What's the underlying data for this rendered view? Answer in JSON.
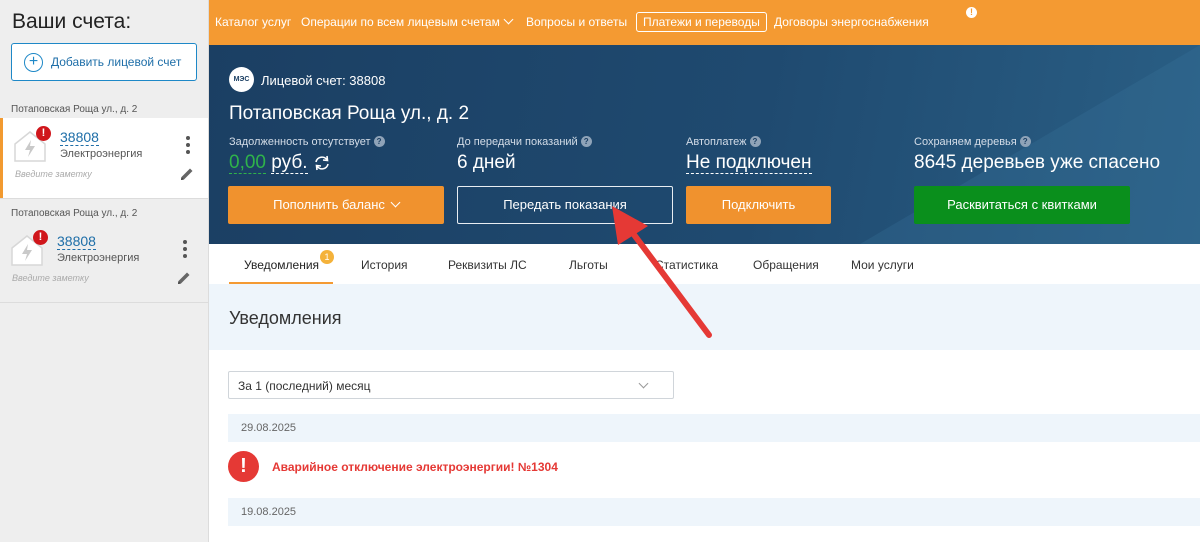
{
  "sidebar": {
    "title": "Ваши счета:",
    "add_button": "Добавить лицевой счет",
    "accounts": [
      {
        "address": "Потаповская Роща ул., д. 2",
        "number": "38808",
        "type": "Электроэнергия",
        "note_placeholder": "Введите заметку",
        "badge": "!"
      },
      {
        "address": "Потаповская Роща ул., д. 2",
        "number": "38808",
        "type": "Электроэнергия",
        "note_placeholder": "Введите заметку",
        "badge": "!"
      }
    ]
  },
  "topnav": {
    "items": [
      "Каталог услуг",
      "Операции по всем лицевым счетам",
      "Вопросы и ответы",
      "Платежи и переводы",
      "Договоры энергоснабжения"
    ],
    "dot": "!"
  },
  "hero": {
    "logo": "МЭС",
    "account_label": "Лицевой счет: 38808",
    "address": "Потаповская Роща ул., д. 2",
    "debt_caption": "Задолженность отсутствует",
    "debt_amount": "0,00",
    "debt_currency": "руб.",
    "readings_caption": "До передачи показаний",
    "readings_value": "6 дней",
    "autopay_caption": "Автоплатеж",
    "autopay_value": "Не подключен",
    "trees_caption": "Сохраняем деревья",
    "trees_value": "8645 деревьев уже спасено",
    "help": "?",
    "buttons": {
      "topup": "Пополнить баланс",
      "submit_readings": "Передать показания",
      "connect": "Подключить",
      "receipts": "Расквитаться с квитками"
    }
  },
  "tabs": {
    "items": [
      "Уведомления",
      "История",
      "Реквизиты ЛС",
      "Льготы",
      "Статистика",
      "Обращения",
      "Мои услуги"
    ],
    "badge": "1"
  },
  "content": {
    "title": "Уведомления",
    "period": "За 1 (последний) месяц",
    "dates": [
      "29.08.2025",
      "19.08.2025"
    ],
    "alert_icon": "!",
    "alert_text": "Аварийное отключение электроэнергии! №1304"
  },
  "colors": {
    "accent": "#f49a32",
    "hero": "#1f4a70",
    "green": "#0a8f1c",
    "alert": "#e53935",
    "link": "#1e6ea8"
  }
}
